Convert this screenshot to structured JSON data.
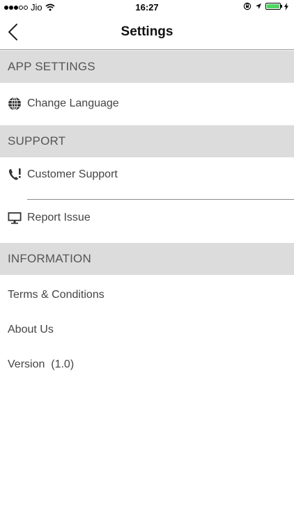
{
  "status_bar": {
    "carrier": "Jio",
    "time": "16:27"
  },
  "nav": {
    "title": "Settings"
  },
  "sections": {
    "app_settings": {
      "header": "APP SETTINGS",
      "change_language": "Change Language"
    },
    "support": {
      "header": "SUPPORT",
      "customer_support": "Customer Support",
      "report_issue": "Report Issue"
    },
    "information": {
      "header": "INFORMATION",
      "terms": "Terms & Conditions",
      "about": "About Us",
      "version": "Version  (1.0)"
    }
  },
  "icons": {
    "language": "globe-icon",
    "customer_support": "phone-alert-icon",
    "report_issue": "monitor-icon",
    "back": "chevron-left-icon"
  },
  "colors": {
    "section_header_bg": "#dcdcdc",
    "battery": "#4cd964",
    "text": "#444444"
  }
}
